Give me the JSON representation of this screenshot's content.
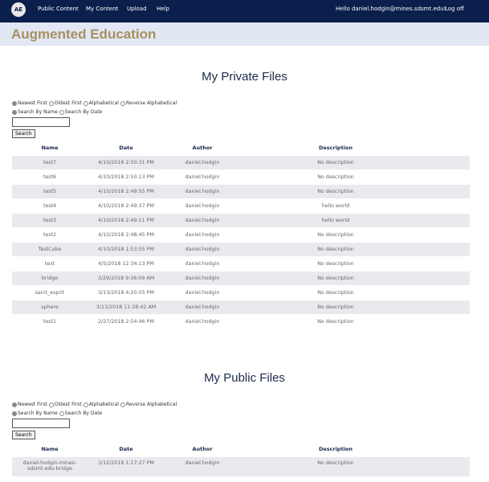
{
  "nav": {
    "logo": "AE",
    "links": [
      "Public Content",
      "My Content",
      "Upload",
      "Help"
    ],
    "greeting": "Hello daniel.hodgin@mines.sdsmt.edu!",
    "logoff": "Log off"
  },
  "banner": {
    "title": "Augmented Education"
  },
  "sort_options": [
    "Newest First",
    "Oldest First",
    "Alphabetical",
    "Reverse Alphabetical"
  ],
  "search_options": [
    "Search By Name",
    "Search By Date"
  ],
  "search_button": "Search",
  "columns": [
    "Name",
    "Date",
    "Author",
    "Description"
  ],
  "private": {
    "title": "My Private Files",
    "rows": [
      {
        "name": "test7",
        "date": "4/10/2018 2:50:31 PM",
        "author": "daniel.hodgin",
        "description": "No description"
      },
      {
        "name": "test6",
        "date": "4/10/2018 2:50:13 PM",
        "author": "daniel.hodgin",
        "description": "No description"
      },
      {
        "name": "test5",
        "date": "4/10/2018 2:49:55 PM",
        "author": "daniel.hodgin",
        "description": "No description"
      },
      {
        "name": "test4",
        "date": "4/10/2018 2:49:37 PM",
        "author": "daniel.hodgin",
        "description": "hello world"
      },
      {
        "name": "test3",
        "date": "4/10/2018 2:49:11 PM",
        "author": "daniel.hodgin",
        "description": "hello world"
      },
      {
        "name": "test2",
        "date": "4/10/2018 2:48:45 PM",
        "author": "daniel.hodgin",
        "description": "No description"
      },
      {
        "name": "TestCube",
        "date": "4/10/2018 1:53:55 PM",
        "author": "daniel.hodgin",
        "description": "No description"
      },
      {
        "name": "text",
        "date": "4/5/2018 12:34:13 PM",
        "author": "daniel.hodgin",
        "description": "No description"
      },
      {
        "name": "bridge",
        "date": "3/29/2018 9:36:09 AM",
        "author": "daniel.hodgin",
        "description": "No description"
      },
      {
        "name": "saint_esprit",
        "date": "3/13/2018 4:20:05 PM",
        "author": "daniel.hodgin",
        "description": "No description"
      },
      {
        "name": "sphere",
        "date": "3/13/2018 11:28:42 AM",
        "author": "daniel.hodgin",
        "description": "No description"
      },
      {
        "name": "test1",
        "date": "2/27/2018 2:54:46 PM",
        "author": "daniel.hodgin",
        "description": "No description"
      }
    ]
  },
  "public": {
    "title": "My Public Files",
    "rows": [
      {
        "name": "daniel-hodgin-mines-sdsmt-edu-bridge",
        "date": "3/12/2018 1:17:27 PM",
        "author": "daniel.hodgin",
        "description": "No description"
      }
    ]
  }
}
